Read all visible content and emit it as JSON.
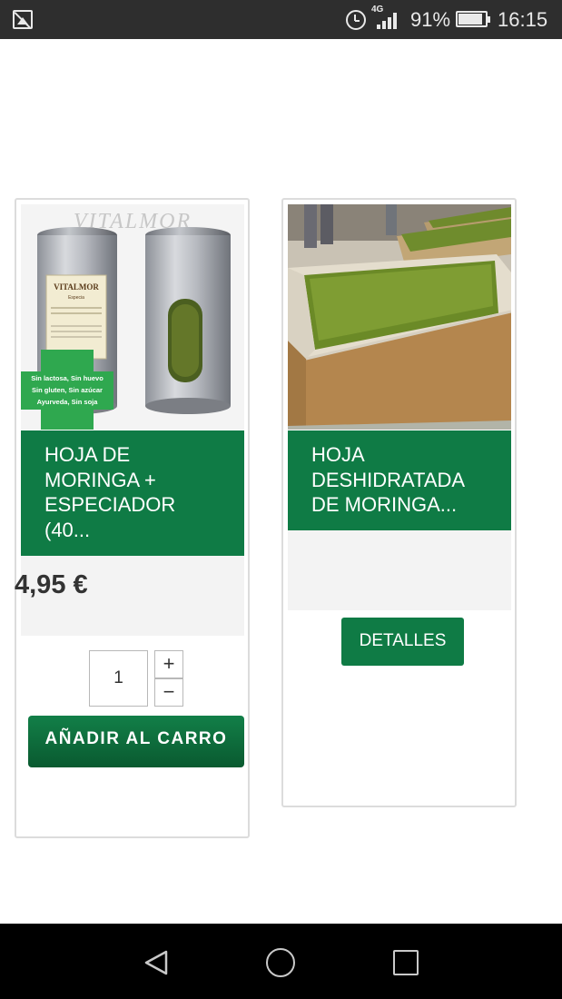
{
  "status_bar": {
    "network": "4G",
    "battery": "91%",
    "battery_level": 0.91,
    "time": "16:15"
  },
  "products": [
    {
      "title": "HOJA DE MORINGA + ESPECIADOR (40...",
      "price": "4,95 €",
      "quantity": "1",
      "plus_label": "+",
      "minus_label": "−",
      "add_to_cart_label": "AÑADIR AL CARRO",
      "image": {
        "brand_watermark": "VITALMOR",
        "label_brand": "VITALMOR",
        "label_subtitle": "Especia",
        "badge_lines": [
          "Sin lactosa, Sin huevo",
          "Sin gluten, Sin azúcar",
          "Ayurveda, Sin soja"
        ]
      }
    },
    {
      "title": "HOJA DESHIDRATADA DE MORINGA...",
      "details_label": "DETALLES"
    }
  ],
  "nav_bar": {
    "icons": [
      "back-icon",
      "home-icon",
      "recent-apps-icon"
    ]
  },
  "colors": {
    "brand_green": "#0f7b45",
    "status_bar": "#2e2e2e",
    "grey_panel": "#f3f3f3"
  }
}
